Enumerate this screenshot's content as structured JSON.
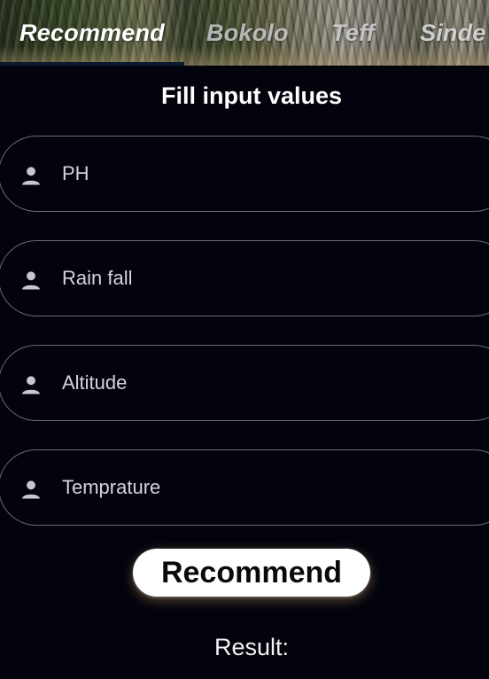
{
  "tabs": {
    "active": "Recommend",
    "items": [
      "Recommend",
      "Bokolo",
      "Teff",
      "Sinde"
    ]
  },
  "form": {
    "heading": "Fill input values",
    "fields": [
      {
        "placeholder": "PH",
        "icon": "person-icon"
      },
      {
        "placeholder": "Rain fall",
        "icon": "person-icon"
      },
      {
        "placeholder": "Altitude",
        "icon": "person-icon"
      },
      {
        "placeholder": "Temprature",
        "icon": "person-icon"
      }
    ],
    "submit_label": "Recommend"
  },
  "result": {
    "label": "Result:"
  },
  "colors": {
    "background": "#03030d",
    "field_border": "#6a6a78",
    "button_bg": "#ffffff",
    "button_text": "#0a0a0a"
  }
}
